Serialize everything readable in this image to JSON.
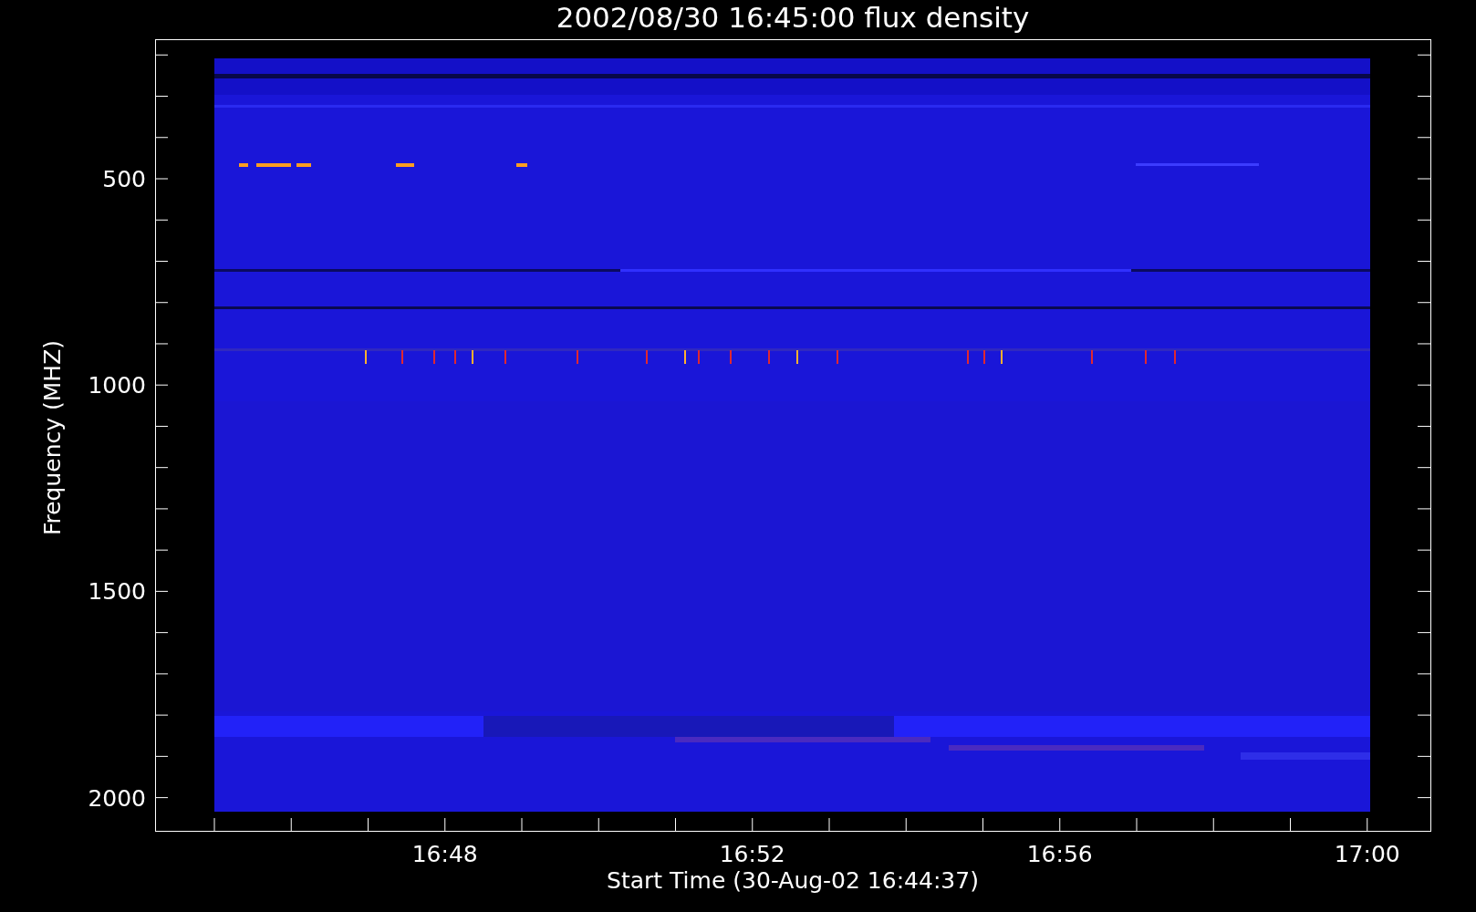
{
  "title": "2002/08/30 16:45:00 flux density",
  "y_axis": {
    "label": "Frequency (MHZ)",
    "ticks": [
      "500",
      "1000",
      "1500",
      "2000"
    ]
  },
  "x_axis": {
    "label": "Start Time (30-Aug-02 16:44:37)",
    "ticks": [
      "16:48",
      "16:52",
      "16:56",
      "17:00"
    ]
  }
}
